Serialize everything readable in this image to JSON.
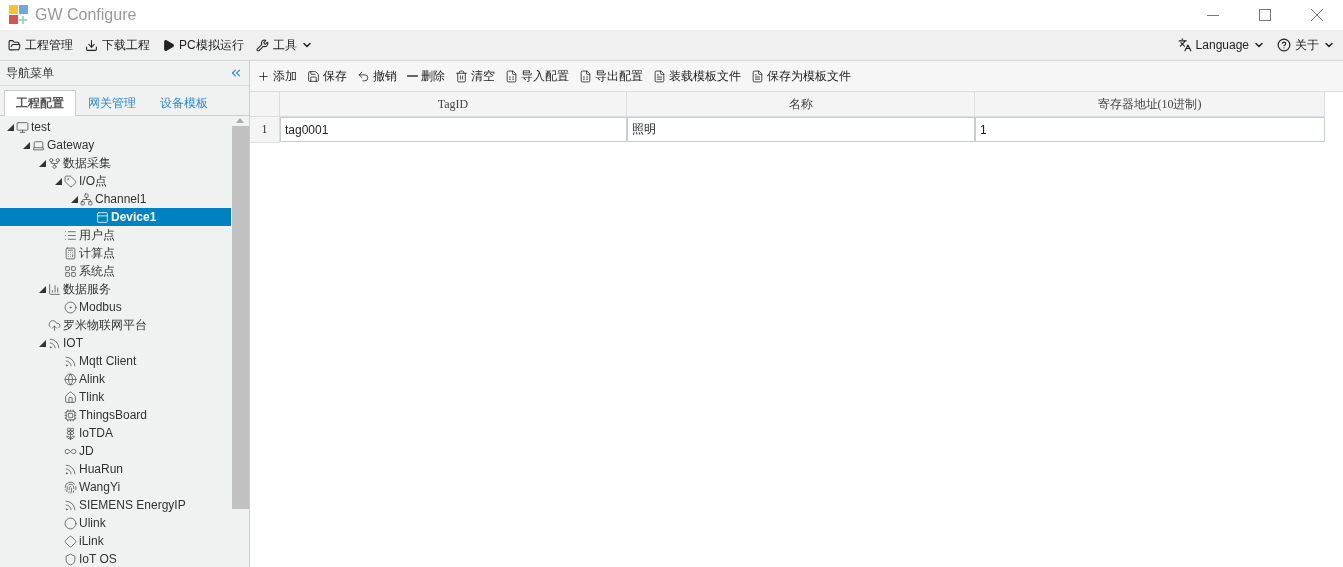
{
  "window": {
    "title": "GW Configure"
  },
  "menu": {
    "left": [
      {
        "label": "工程管理",
        "dropdown": false
      },
      {
        "label": "下载工程",
        "dropdown": false
      },
      {
        "label": "PC模拟运行",
        "dropdown": false
      },
      {
        "label": "工具",
        "dropdown": true
      }
    ],
    "right": [
      {
        "label": "Language",
        "dropdown": true
      },
      {
        "label": "关于",
        "dropdown": true
      }
    ]
  },
  "sidebar": {
    "title": "导航菜单",
    "tabs": [
      {
        "label": "工程配置",
        "selected": true
      },
      {
        "label": "网关管理",
        "selected": false
      },
      {
        "label": "设备模板",
        "selected": false
      }
    ],
    "tree": [
      {
        "label": "test",
        "expanded": true,
        "selected": false,
        "children": [
          {
            "label": "Gateway",
            "expanded": true,
            "selected": false,
            "children": [
              {
                "label": "数据采集",
                "expanded": true,
                "selected": false,
                "children": [
                  {
                    "label": "I/O点",
                    "expanded": true,
                    "selected": false,
                    "children": [
                      {
                        "label": "Channel1",
                        "expanded": true,
                        "selected": false,
                        "children": [
                          {
                            "label": "Device1",
                            "selected": true
                          }
                        ]
                      }
                    ]
                  },
                  {
                    "label": "用户点",
                    "selected": false
                  },
                  {
                    "label": "计算点",
                    "selected": false
                  },
                  {
                    "label": "系统点",
                    "selected": false
                  }
                ]
              },
              {
                "label": "数据服务",
                "expanded": true,
                "selected": false,
                "children": [
                  {
                    "label": "Modbus",
                    "selected": false
                  }
                ]
              },
              {
                "label": "罗米物联网平台",
                "selected": false
              },
              {
                "label": "IOT",
                "expanded": true,
                "selected": false,
                "children": [
                  {
                    "label": "Mqtt Client",
                    "selected": false
                  },
                  {
                    "label": "Alink",
                    "selected": false
                  },
                  {
                    "label": "Tlink",
                    "selected": false
                  },
                  {
                    "label": "ThingsBoard",
                    "selected": false
                  },
                  {
                    "label": "IoTDA",
                    "selected": false
                  },
                  {
                    "label": "JD",
                    "selected": false
                  },
                  {
                    "label": "HuaRun",
                    "selected": false
                  },
                  {
                    "label": "WangYi",
                    "selected": false
                  },
                  {
                    "label": "SIEMENS EnergyIP",
                    "selected": false
                  },
                  {
                    "label": "Ulink",
                    "selected": false
                  },
                  {
                    "label": "iLink",
                    "selected": false
                  },
                  {
                    "label": "IoT OS",
                    "selected": false
                  }
                ]
              }
            ]
          }
        ]
      }
    ]
  },
  "toolbar": [
    "添加",
    "保存",
    "撤销",
    "删除",
    "清空",
    "导入配置",
    "导出配置",
    "装载模板文件",
    "保存为模板文件"
  ],
  "table": {
    "columns": [
      "TagID",
      "名称",
      "寄存器地址(10进制)"
    ],
    "rows": [
      {
        "number": "1",
        "cells": [
          "tag0001",
          "照明",
          "1"
        ]
      }
    ]
  }
}
